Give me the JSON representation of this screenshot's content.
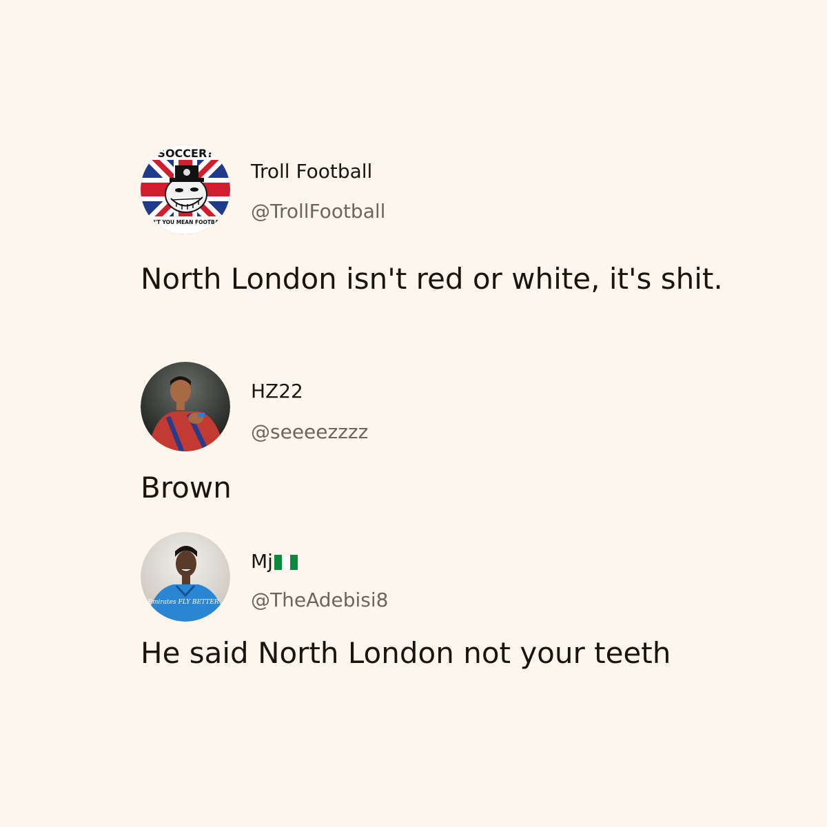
{
  "posts": [
    {
      "display_name": "Troll Football",
      "handle": "@TrollFootball",
      "text": "North London isn't red or white, it's shit.",
      "avatar": {
        "icon": "troll-face-union-jack-avatar",
        "top_text": "SOCCER?",
        "bottom_text": "DON'T YOU MEAN FOOTBALL?"
      }
    },
    {
      "display_name": "HZ22",
      "handle": "@seeeezzzz",
      "text": "Brown",
      "avatar": {
        "icon": "player-photo-avatar"
      }
    },
    {
      "display_name": "Mj",
      "display_name_emoji": "nigeria-flag-icon",
      "handle": "@TheAdebisi8",
      "text": "He said North London not your teeth",
      "avatar": {
        "icon": "player-photo-avatar",
        "shirt_text": "Emirates FLY BETTER"
      }
    }
  ],
  "colors": {
    "background": "#fcf6ec",
    "text": "#1a1410",
    "handle": "#6b6560"
  }
}
